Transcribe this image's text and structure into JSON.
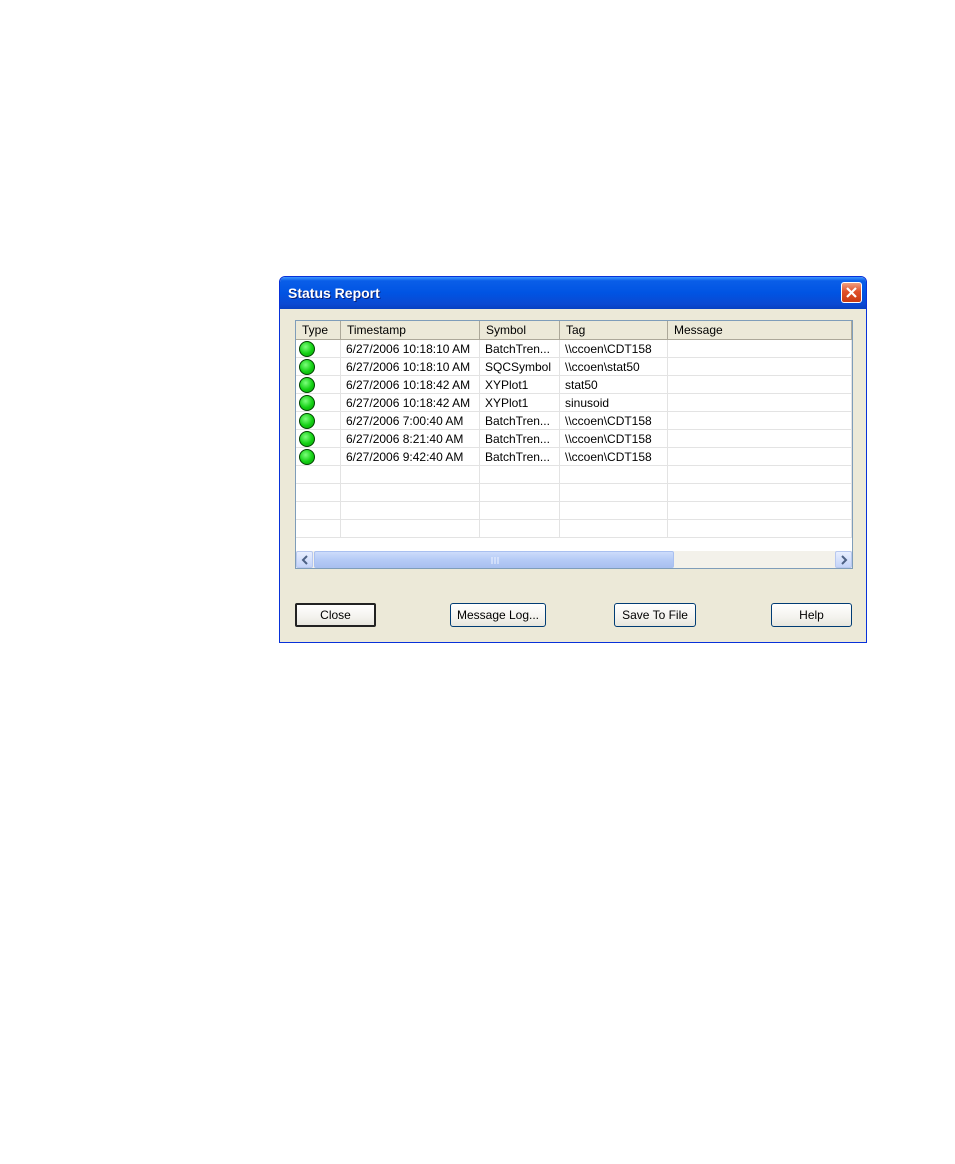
{
  "window": {
    "title": "Status Report"
  },
  "list": {
    "columns": [
      "Type",
      "Timestamp",
      "Symbol",
      "Tag",
      "Message"
    ],
    "rows": [
      {
        "type_icon": "green-status-icon",
        "timestamp": "6/27/2006 10:18:10 AM",
        "symbol": "BatchTren...",
        "tag": "\\\\ccoen\\CDT158",
        "message": ""
      },
      {
        "type_icon": "green-status-icon",
        "timestamp": "6/27/2006 10:18:10 AM",
        "symbol": "SQCSymbol",
        "tag": "\\\\ccoen\\stat50",
        "message": ""
      },
      {
        "type_icon": "green-status-icon",
        "timestamp": "6/27/2006 10:18:42 AM",
        "symbol": "XYPlot1",
        "tag": "stat50",
        "message": ""
      },
      {
        "type_icon": "green-status-icon",
        "timestamp": "6/27/2006 10:18:42 AM",
        "symbol": "XYPlot1",
        "tag": "sinusoid",
        "message": ""
      },
      {
        "type_icon": "green-status-icon",
        "timestamp": "6/27/2006 7:00:40 AM",
        "symbol": "BatchTren...",
        "tag": "\\\\ccoen\\CDT158",
        "message": ""
      },
      {
        "type_icon": "green-status-icon",
        "timestamp": "6/27/2006 8:21:40 AM",
        "symbol": "BatchTren...",
        "tag": "\\\\ccoen\\CDT158",
        "message": ""
      },
      {
        "type_icon": "green-status-icon",
        "timestamp": "6/27/2006 9:42:40 AM",
        "symbol": "BatchTren...",
        "tag": "\\\\ccoen\\CDT158",
        "message": ""
      }
    ],
    "empty_rows": 4
  },
  "buttons": {
    "close": "Close",
    "message_log": "Message Log...",
    "save_to_file": "Save To File",
    "help": "Help"
  },
  "colors": {
    "title_bar": "#0054e3",
    "status_ok": "#13d013",
    "dialog_bg": "#ece9d8"
  }
}
